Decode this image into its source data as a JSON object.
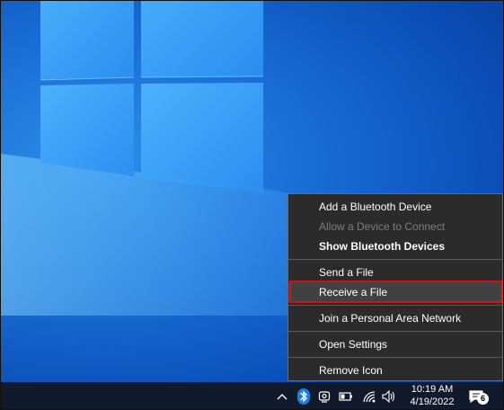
{
  "context_menu": {
    "items": [
      {
        "label": "Add a Bluetooth Device"
      },
      {
        "label": "Allow a Device to Connect"
      },
      {
        "label": "Show Bluetooth Devices"
      },
      {
        "label": "Send a File"
      },
      {
        "label": "Receive a File"
      },
      {
        "label": "Join a Personal Area Network"
      },
      {
        "label": "Open Settings"
      },
      {
        "label": "Remove Icon"
      }
    ]
  },
  "taskbar": {
    "clock": {
      "time": "10:19 AM",
      "date": "4/19/2022"
    },
    "notification_count": "6",
    "tray_icons": [
      "chevron-up-icon",
      "bluetooth-icon",
      "camera-icon",
      "battery-icon",
      "wifi-icon",
      "volume-icon",
      "notification-icon"
    ]
  },
  "colors": {
    "menu_background": "#2b2b2b",
    "highlight_border": "#d2121b",
    "taskbar": "#101a2a",
    "desktop_blue": "#1a6fd6"
  }
}
